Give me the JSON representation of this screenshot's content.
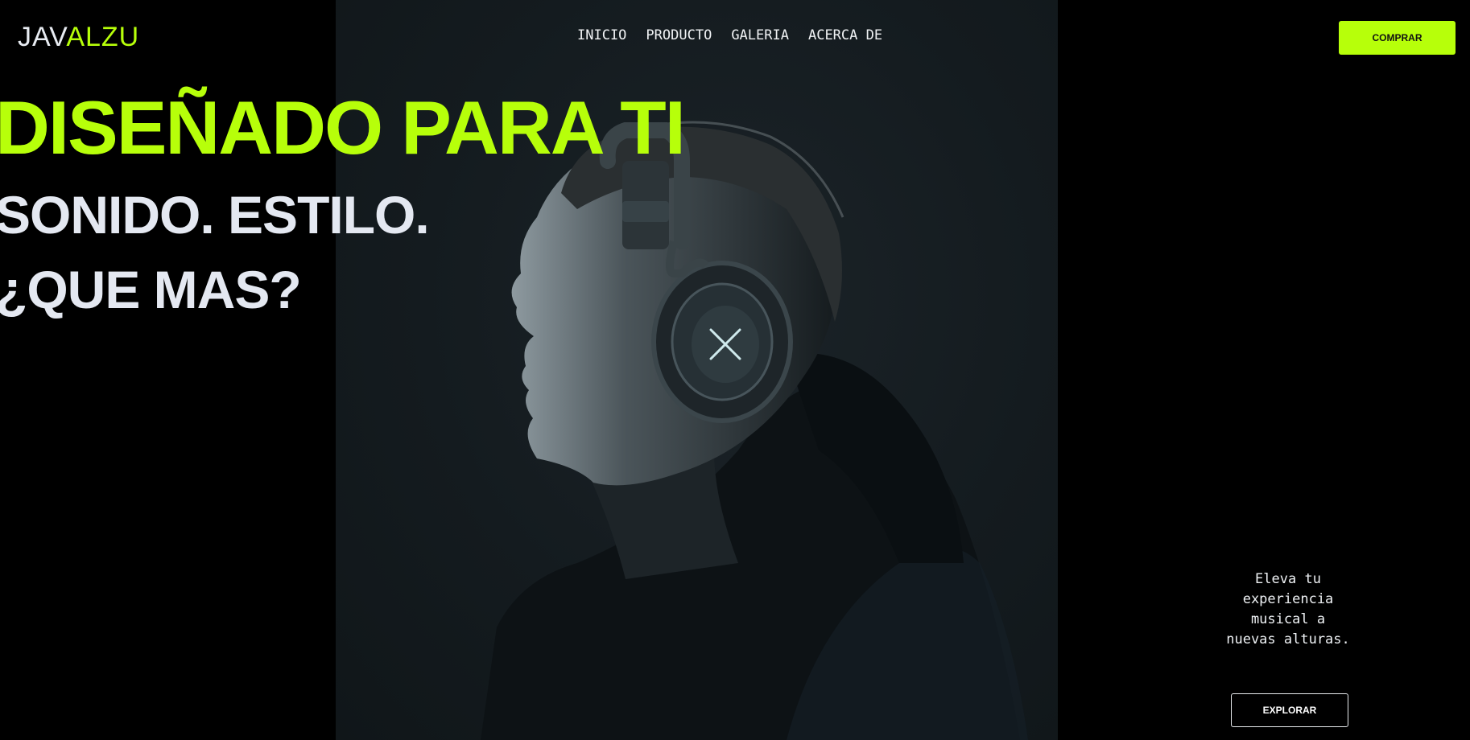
{
  "brand": {
    "logo_part1": "JAV",
    "logo_part2": "ALZU"
  },
  "nav": {
    "items": [
      {
        "label": "INICIO"
      },
      {
        "label": "PRODUCTO"
      },
      {
        "label": "GALERIA"
      },
      {
        "label": "ACERCA DE"
      }
    ]
  },
  "header": {
    "buy_label": "COMPRAR"
  },
  "hero": {
    "headline": "DISEÑADO PARA TI",
    "subline1": "SONIDO. ESTILO.",
    "subline2": "¿QUE MAS?",
    "image_icon": "person-with-headphones"
  },
  "cta": {
    "tagline": "Eleva tu experiencia musical a nuevas alturas.",
    "explore_label": "EXPLORAR"
  },
  "colors": {
    "background": "#000000",
    "accent": "#b7ff0a",
    "text": "#e4e8f1",
    "panel": "#141b1f"
  }
}
